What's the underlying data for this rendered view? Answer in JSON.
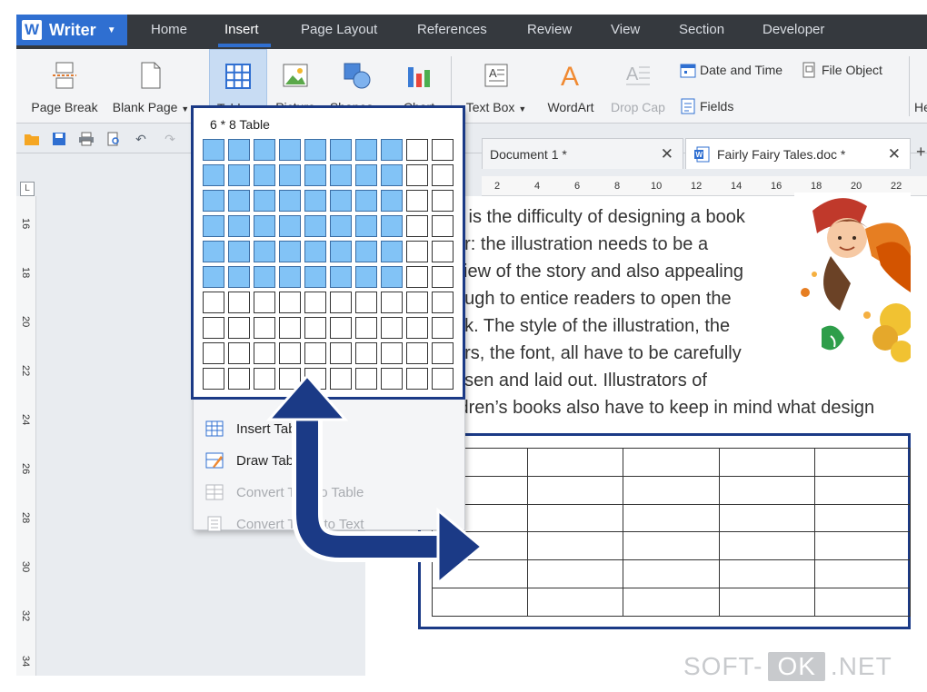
{
  "app": {
    "name": "Writer",
    "logo_letter": "W"
  },
  "menu": {
    "tabs": [
      "Home",
      "Insert",
      "Page Layout",
      "References",
      "Review",
      "View",
      "Section",
      "Developer"
    ],
    "active": "Insert"
  },
  "ribbon": {
    "page_break": "Page Break",
    "blank_page": "Blank Page",
    "table": "Table",
    "picture": "Picture",
    "shapes": "Shapes",
    "chart": "Chart",
    "text_box": "Text Box",
    "wordart": "WordArt",
    "drop_cap": "Drop Cap",
    "date_time": "Date and Time",
    "file_object": "File Object",
    "fields": "Fields",
    "cut_off": "He",
    "caret": "˅"
  },
  "doc_tabs": [
    {
      "label": "Document 1 *"
    },
    {
      "label": "Fairly Fairy Tales.doc *"
    }
  ],
  "icons": {
    "close": "✕",
    "plus": "+"
  },
  "ruler": {
    "h_marks": [
      "2",
      "4",
      "6",
      "8",
      "10",
      "12",
      "14",
      "16",
      "18",
      "20",
      "22"
    ],
    "v_marks": [
      "16",
      "18",
      "20",
      "22",
      "24",
      "26",
      "28",
      "30",
      "32",
      "34"
    ],
    "corner": "L"
  },
  "table_dropdown": {
    "title": "6 * 8 Table",
    "grid_cols": 10,
    "grid_rows": 10,
    "selected_rows": 6,
    "selected_cols": 8,
    "items": [
      {
        "label": "Insert Table",
        "disabled": false
      },
      {
        "label": "Draw Table",
        "disabled": false
      },
      {
        "label": "Convert Text to Table",
        "disabled": true
      },
      {
        "label": "Convert Table to Text",
        "disabled": true
      }
    ]
  },
  "document": {
    "lines": [
      "s is the difficulty of designing a book",
      "er: the illustration needs to be a",
      "view of the story and also appealing",
      "ough to entice readers to open the",
      "ok. The style of the illustration, the",
      "ors, the font, all have to be carefully",
      "osen and laid out. Illustrators of"
    ],
    "last_line": "ldren’s books also have to keep in mind what design",
    "table_rows": 6,
    "table_cols": 5
  },
  "watermark": {
    "left": "SOFT-",
    "mid": "OK",
    "right": ".NET"
  },
  "colors": {
    "accent": "#2f6fd1",
    "highlight": "#82c3f6",
    "arrow": "#1b3a86",
    "menubar": "#35393e"
  }
}
